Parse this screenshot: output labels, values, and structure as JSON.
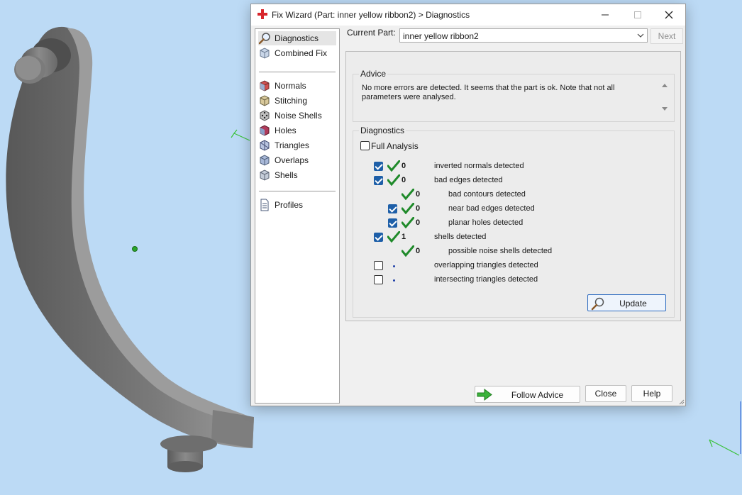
{
  "window": {
    "title": "Fix Wizard (Part: inner yellow  ribbon2) > Diagnostics",
    "icon": "red-cross-icon",
    "controls": [
      "minimize-icon",
      "maximize-icon",
      "close-icon"
    ]
  },
  "sidebar": {
    "items": [
      {
        "label": "Diagnostics",
        "icon": "magnifier-icon",
        "selected": true
      },
      {
        "label": "Combined Fix",
        "icon": "cube-icon"
      },
      {
        "label": "Normals",
        "icon": "cube-red-icon"
      },
      {
        "label": "Stitching",
        "icon": "cube-stitch-icon"
      },
      {
        "label": "Noise Shells",
        "icon": "dice-icon"
      },
      {
        "label": "Holes",
        "icon": "cube-holes-icon"
      },
      {
        "label": "Triangles",
        "icon": "triangle-icon"
      },
      {
        "label": "Overlaps",
        "icon": "overlap-icon"
      },
      {
        "label": "Shells",
        "icon": "shells-icon"
      },
      {
        "label": "Profiles",
        "icon": "document-icon"
      }
    ]
  },
  "part": {
    "label": "Current Part:",
    "value": "inner yellow  ribbon2",
    "next_label": "Next"
  },
  "advice": {
    "title": "Advice",
    "text": "No more errors are detected. It seems that the part is ok. Note that not all parameters were analysed."
  },
  "diagnostics": {
    "title": "Diagnostics",
    "full_analysis_label": "Full Analysis",
    "full_analysis_checked": false,
    "rows": [
      {
        "checkbox": true,
        "checked": true,
        "status": "ok",
        "count": "0",
        "label": "inverted normals detected",
        "indent": false
      },
      {
        "checkbox": true,
        "checked": true,
        "status": "ok",
        "count": "0",
        "label": "bad edges detected",
        "indent": false
      },
      {
        "checkbox": false,
        "checked": false,
        "status": "ok",
        "count": "0",
        "label": "bad contours detected",
        "indent": true
      },
      {
        "checkbox": true,
        "checked": true,
        "status": "ok",
        "count": "0",
        "label": "near bad edges detected",
        "indent": true
      },
      {
        "checkbox": true,
        "checked": true,
        "status": "ok",
        "count": "0",
        "label": "planar holes detected",
        "indent": true
      },
      {
        "checkbox": true,
        "checked": true,
        "status": "ok",
        "count": "1",
        "label": "shells detected",
        "indent": false
      },
      {
        "checkbox": false,
        "checked": false,
        "status": "ok",
        "count": "0",
        "label": "possible noise shells detected",
        "indent": true
      },
      {
        "checkbox": true,
        "checked": false,
        "status": "pending",
        "count": "",
        "label": "overlapping triangles detected",
        "indent": false
      },
      {
        "checkbox": true,
        "checked": false,
        "status": "pending",
        "count": "",
        "label": "intersecting triangles detected",
        "indent": false
      }
    ],
    "update_label": "Update"
  },
  "buttons": {
    "follow_advice": "Follow Advice",
    "close": "Close",
    "help": "Help"
  },
  "colors": {
    "background": "#bcdaf5",
    "model_gray": "#6e6e6e",
    "checkbox_blue": "#1e5fa8",
    "ok_green": "#1f8a2a",
    "title_icon_red": "#d8262c"
  }
}
